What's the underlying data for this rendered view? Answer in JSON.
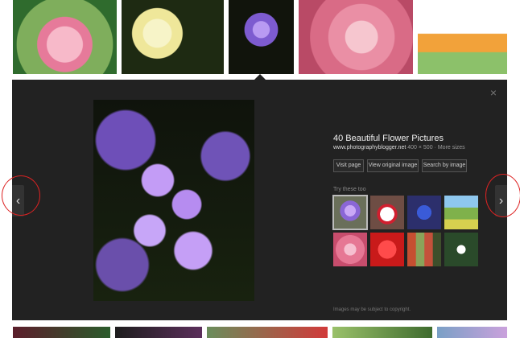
{
  "top_thumbnails": [
    {
      "name": "lotus"
    },
    {
      "name": "yellow-lilies"
    },
    {
      "name": "purple-flowers"
    },
    {
      "name": "pink-dahlia"
    },
    {
      "name": "orange-tulips"
    }
  ],
  "preview": {
    "title": "40 Beautiful Flower Pictures",
    "domain": "www.photographyblogger.net",
    "dimensions": "400 × 500",
    "more_sizes": "More sizes",
    "buttons": {
      "visit_page": "Visit page",
      "view_original": "View original image",
      "search_by_image": "Search by image"
    },
    "related_label": "Try these too",
    "footnote": "Images may be subject to copyright."
  },
  "nav": {
    "left_arrow": "‹",
    "right_arrow": "›",
    "close": "×"
  },
  "colors": {
    "panel_bg": "#222222",
    "annotation_red": "#dd2222"
  }
}
